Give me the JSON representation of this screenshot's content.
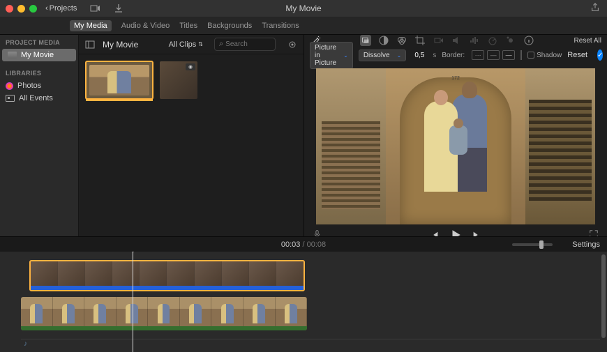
{
  "titlebar": {
    "back_label": "Projects",
    "app_title": "My Movie"
  },
  "tabs": {
    "my_media": "My Media",
    "audio_video": "Audio & Video",
    "titles": "Titles",
    "backgrounds": "Backgrounds",
    "transitions": "Transitions"
  },
  "sidebar": {
    "project_media_hdr": "PROJECT MEDIA",
    "my_movie": "My Movie",
    "libraries_hdr": "LIBRARIES",
    "photos": "Photos",
    "all_events": "All Events"
  },
  "browser": {
    "title": "My Movie",
    "clips_filter": "All Clips",
    "search_placeholder": "Search"
  },
  "viewer_tb": {
    "reset_all": "Reset All"
  },
  "pip_bar": {
    "mode": "Picture in Picture",
    "transition": "Dissolve",
    "duration": "0,5",
    "seconds": "s",
    "border_label": "Border:",
    "shadow_label": "Shadow",
    "reset": "Reset"
  },
  "timecode": {
    "current": "00:03",
    "sep": " / ",
    "total": "00:08",
    "settings": "Settings"
  }
}
